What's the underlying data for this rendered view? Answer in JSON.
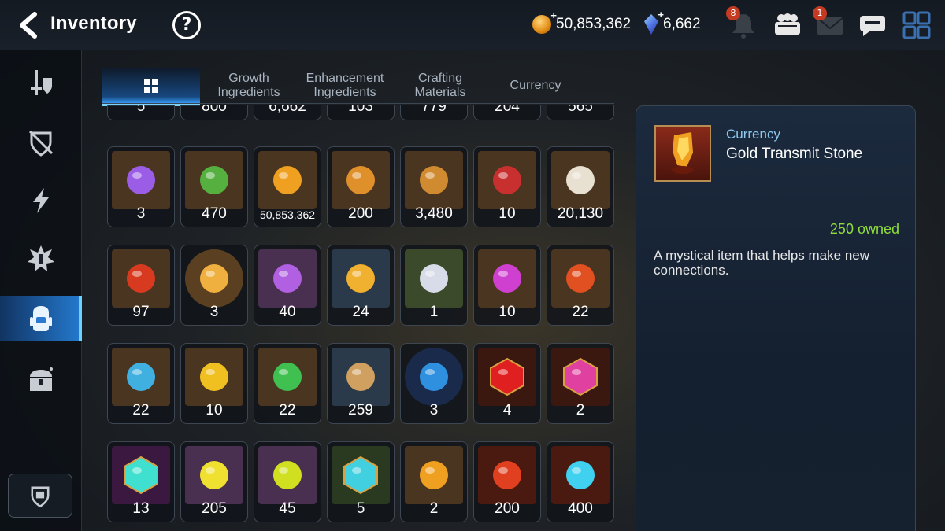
{
  "header": {
    "title": "Inventory",
    "help_label": "?",
    "gold": "50,853,362",
    "crystals": "6,662",
    "notifications_badge": "8",
    "mail_badge": "1",
    "plus": "+"
  },
  "sidebar": {
    "items": [
      {
        "name": "equipment",
        "icon": "sword-shield-icon"
      },
      {
        "name": "protection",
        "icon": "shield-slash-icon"
      },
      {
        "name": "skills",
        "icon": "lightning-icon"
      },
      {
        "name": "artifacts",
        "icon": "spiky-emblem-icon"
      },
      {
        "name": "items",
        "icon": "backpack-icon",
        "active": true
      },
      {
        "name": "chests",
        "icon": "treasure-chest-icon"
      }
    ],
    "bottom": "guild-shield-icon"
  },
  "tabs": [
    {
      "label": "",
      "icon": "grid-icon",
      "active": true
    },
    {
      "label": "Growth\nIngredients"
    },
    {
      "label": "Enhancement\nIngredients"
    },
    {
      "label": "Crafting\nMaterials"
    },
    {
      "label": "Currency"
    }
  ],
  "items": [
    {
      "qty": "5",
      "color": "#5a3a7a",
      "icon": "item-icon"
    },
    {
      "qty": "800",
      "color": "#6a2a2a",
      "icon": "item-icon"
    },
    {
      "qty": "6,662",
      "color": "#2a3a6a",
      "icon": "item-icon"
    },
    {
      "qty": "103",
      "color": "#3a3020",
      "icon": "item-icon"
    },
    {
      "qty": "779",
      "color": "#3a3020",
      "icon": "item-icon"
    },
    {
      "qty": "204",
      "color": "#3a3020",
      "icon": "item-icon"
    },
    {
      "qty": "565",
      "color": "#2a3a6a",
      "icon": "item-icon"
    },
    {
      "qty": "3",
      "color": "#4a3520",
      "icon": "purple-badge-icon",
      "glyph": "#9b5de5"
    },
    {
      "qty": "470",
      "color": "#4a3520",
      "icon": "green-heart-icon",
      "glyph": "#55b040"
    },
    {
      "qty": "50,853,362",
      "color": "#4a3520",
      "icon": "gold-coin-icon",
      "glyph": "#f0a020",
      "small": true
    },
    {
      "qty": "200",
      "color": "#4a3520",
      "icon": "gold-emblem-icon",
      "glyph": "#e0902a"
    },
    {
      "qty": "3,480",
      "color": "#4a3520",
      "icon": "fist-emblem-icon",
      "glyph": "#d08a30"
    },
    {
      "qty": "10",
      "color": "#4a3520",
      "icon": "banner-icon",
      "glyph": "#c83030"
    },
    {
      "qty": "20,130",
      "color": "#4a3520",
      "icon": "knight-chess-icon",
      "glyph": "#e8e0d0"
    },
    {
      "qty": "97",
      "color": "#4a3520",
      "icon": "red-leaf-icon",
      "glyph": "#d83a20"
    },
    {
      "qty": "3",
      "color": "#5a4020",
      "icon": "character-portrait-icon",
      "glyph": "#f0b040",
      "round": true
    },
    {
      "qty": "40",
      "color": "#4a3050",
      "icon": "purple-lotus-icon",
      "glyph": "#b060e0"
    },
    {
      "qty": "24",
      "color": "#2a3a4a",
      "icon": "gold-lotus-icon",
      "glyph": "#f0b030"
    },
    {
      "qty": "1",
      "color": "#3a4a2a",
      "icon": "silver-lotus-icon",
      "glyph": "#d8dce8"
    },
    {
      "qty": "10",
      "color": "#4a3520",
      "icon": "purple-rune-icon",
      "glyph": "#d040d0"
    },
    {
      "qty": "22",
      "color": "#4a3520",
      "icon": "red-rune-icon",
      "glyph": "#e05020"
    },
    {
      "qty": "22",
      "color": "#4a3520",
      "icon": "blue-rune-icon",
      "glyph": "#40b0e0"
    },
    {
      "qty": "10",
      "color": "#4a3520",
      "icon": "yellow-rune-icon",
      "glyph": "#f0c020"
    },
    {
      "qty": "22",
      "color": "#4a3520",
      "icon": "green-rune-icon",
      "glyph": "#40c050"
    },
    {
      "qty": "259",
      "color": "#2a3a4a",
      "icon": "root-icon",
      "glyph": "#d0a060"
    },
    {
      "qty": "3",
      "color": "#1a2a4a",
      "icon": "blue-sigil-icon",
      "glyph": "#3090e0",
      "round": true
    },
    {
      "qty": "4",
      "color": "#3a1810",
      "icon": "red-gem-hex-icon",
      "glyph": "#e02020",
      "hex": true
    },
    {
      "qty": "2",
      "color": "#3a1810",
      "icon": "potion-hex-icon",
      "glyph": "#e040a0",
      "hex": true
    },
    {
      "qty": "13",
      "color": "#3a1840",
      "icon": "dark-stone-hex-icon",
      "glyph": "#40e0d0",
      "hex": true
    },
    {
      "qty": "205",
      "color": "#4a3050",
      "icon": "stone-yellow-icon",
      "glyph": "#f0e030"
    },
    {
      "qty": "45",
      "color": "#4a3050",
      "icon": "stone-yellow-2-icon",
      "glyph": "#d0e020"
    },
    {
      "qty": "5",
      "color": "#2a3a20",
      "icon": "white-stone-hex-icon",
      "glyph": "#40d0e0",
      "hex": true
    },
    {
      "qty": "2",
      "color": "#4a3520",
      "icon": "white-stone-icon",
      "glyph": "#f0a020"
    },
    {
      "qty": "200",
      "color": "#4a1a10",
      "icon": "dark-crystal-red-icon",
      "glyph": "#e04020"
    },
    {
      "qty": "400",
      "color": "#4a1a10",
      "icon": "dark-crystal-blue-icon",
      "glyph": "#40d0f0"
    }
  ],
  "detail": {
    "category": "Currency",
    "name": "Gold Transmit Stone",
    "owned": "250 owned",
    "description": "A mystical item that helps make new connections."
  }
}
